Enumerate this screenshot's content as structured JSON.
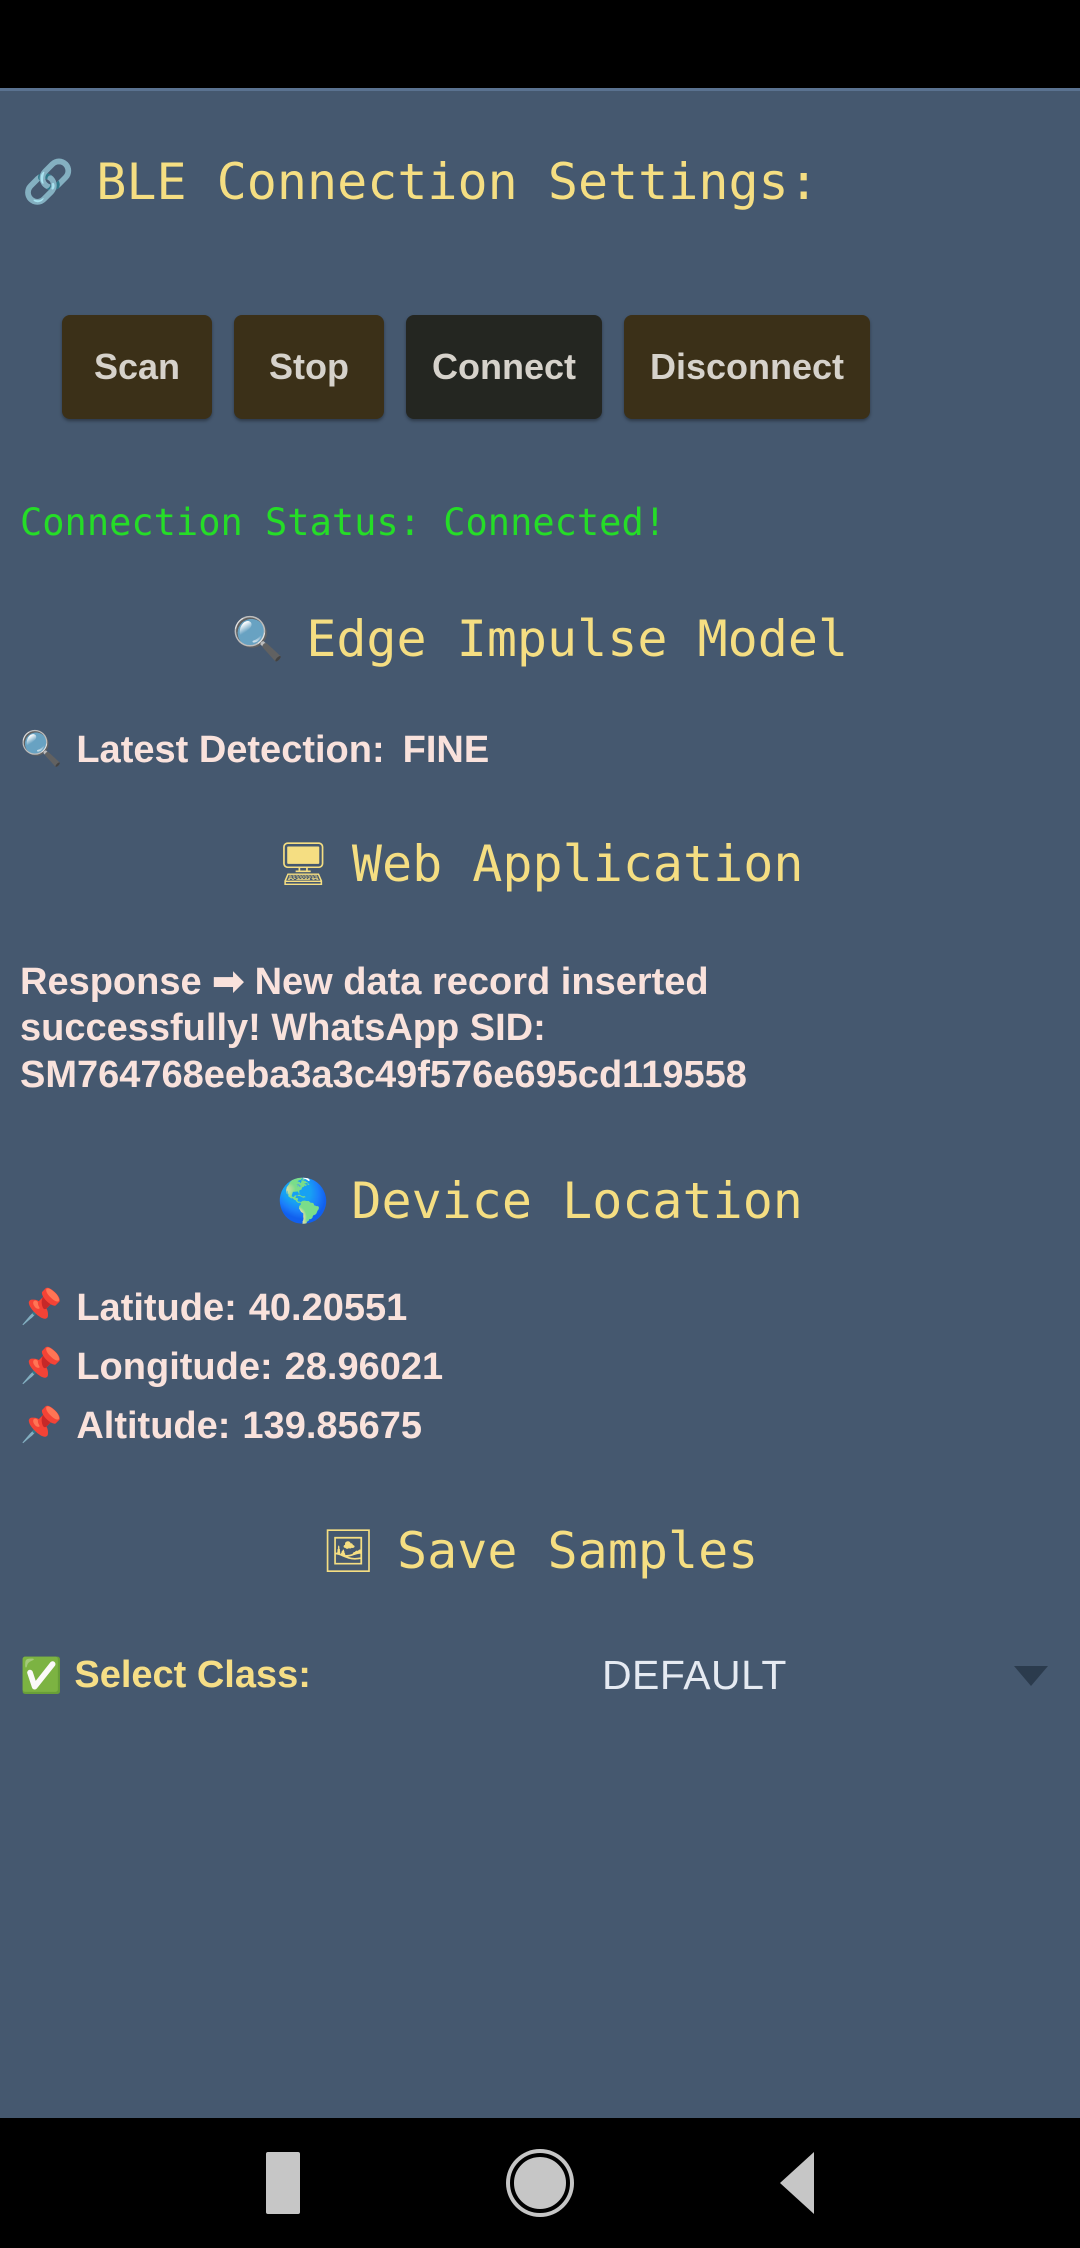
{
  "app": {
    "background_color": "#45586F",
    "accent_yellow": "#F5DE82",
    "status_green": "#25DD27",
    "body_text_color": "#F9E2DC"
  },
  "ble": {
    "icon": "link-icon",
    "icon_glyph": "🔗",
    "title": "BLE Connection Settings:",
    "buttons": [
      {
        "label": "Scan",
        "style": "brown"
      },
      {
        "label": "Stop",
        "style": "brown"
      },
      {
        "label": "Connect",
        "style": "dark"
      },
      {
        "label": "Disconnect",
        "style": "brown"
      }
    ],
    "status_text": "Connection Status: Connected!"
  },
  "model": {
    "icon": "magnifying-glass-icon",
    "icon_glyph": "🔍",
    "title": "Edge Impulse Model",
    "detection_label": "Latest Detection:",
    "detection_value": "FINE"
  },
  "web": {
    "icon": "desktop-computer-icon",
    "icon_glyph": "🖥",
    "title": "Web Application",
    "response_prefix": "Response",
    "response_arrow_glyph": "➡",
    "response_text": "New data record inserted successfully! WhatsApp SID: SM764768eeba3a3c49f576e695cd119558"
  },
  "location": {
    "icon": "globe-americas-icon",
    "icon_glyph": "🌎",
    "title": "Device Location",
    "pin_glyph": "📌",
    "rows": [
      {
        "label": "Latitude:",
        "value": "40.20551"
      },
      {
        "label": "Longitude:",
        "value": "28.96021"
      },
      {
        "label": "Altitude:",
        "value": "139.85675"
      }
    ]
  },
  "samples": {
    "icon": "framed-picture-icon",
    "icon_glyph": "🖼",
    "title": "Save Samples",
    "select_icon_glyph": "✅",
    "select_label": "Select Class:",
    "select_value": "DEFAULT"
  },
  "navbar": {
    "recents": "recents-button",
    "home": "home-button",
    "back": "back-button"
  }
}
